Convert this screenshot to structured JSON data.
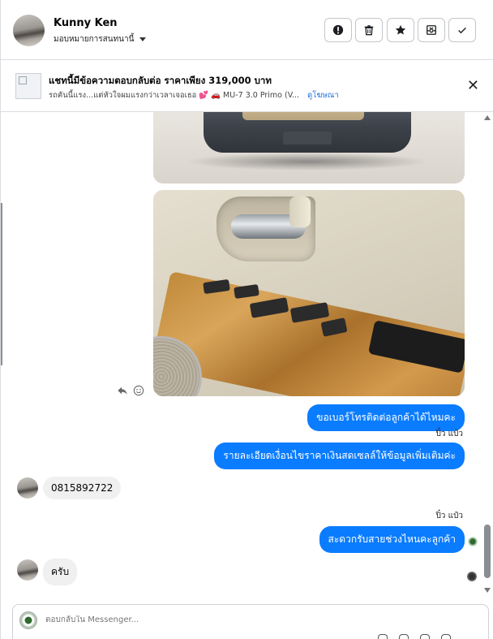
{
  "header": {
    "contact_name": "Kunny Ken",
    "assign_label": "มอบหมายการสนทนานี้",
    "actions": [
      {
        "name": "report-button",
        "icon": "exclamation-icon"
      },
      {
        "name": "delete-button",
        "icon": "trash-icon"
      },
      {
        "name": "star-button",
        "icon": "star-icon"
      },
      {
        "name": "mark-unread-button",
        "icon": "envelope-x-icon"
      },
      {
        "name": "mark-done-button",
        "icon": "check-icon"
      }
    ]
  },
  "ad": {
    "title": "แชทนี้มีข้อความตอบกลับต่อ ราคาเพียง 319,000 บาท",
    "subtitle": "รถคันนี้แรง...แต่หัวใจผมแรงกว่าเวลาเจอเธอ 💕 🚗 MU-7 3.0 Primo (V...",
    "link": "ดูโฆษณา"
  },
  "messages": {
    "out1": "ขอเบอร์โทรติดต่อลูกค้าได้ไหมคะ",
    "sender1": "ปิ๋ว แป๋ว",
    "out2": "รายละเอียดเงื่อนไขราคาเงินสดเซลล์ให้ข้อมูลเพิ่มเติมค่ะ",
    "in1": "0815892722",
    "sender2": "ปิ๋ว แป๋ว",
    "out3": "สะดวกรับสายช่วงไหนคะลูกค้า",
    "in2": "ครับ"
  },
  "composer": {
    "placeholder": "ตอบกลับใน Messenger..."
  },
  "colors": {
    "accent": "#0a7cff",
    "incoming_bubble": "#f0f0f0",
    "link": "#216fdb"
  }
}
